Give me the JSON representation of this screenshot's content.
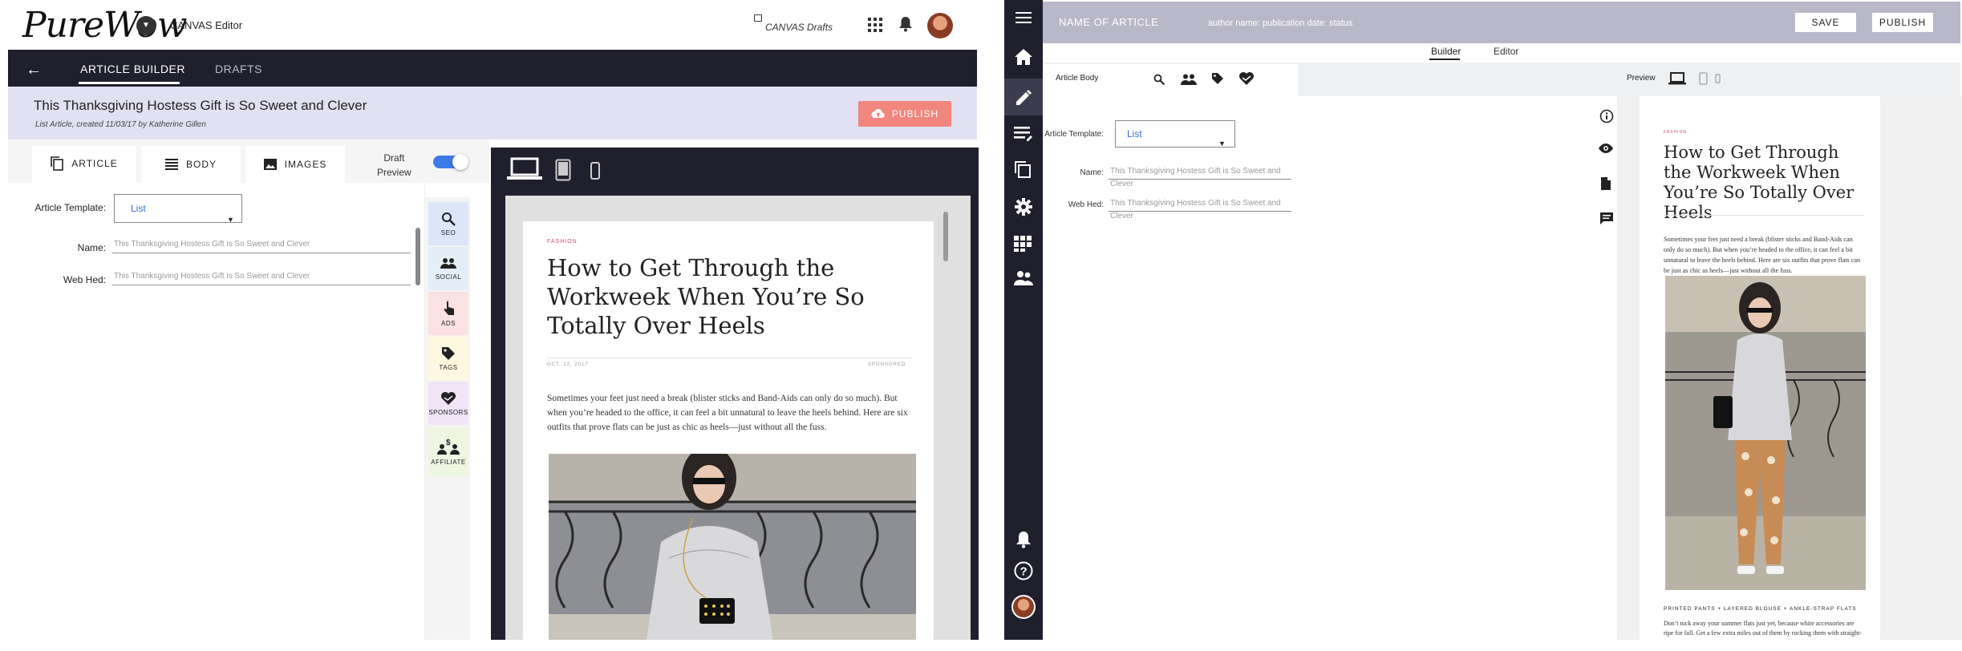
{
  "left": {
    "brand": "PureWow",
    "app_name": "CANVAS Editor",
    "drafts_link": "CANVAS Drafts",
    "nav": {
      "builder_tab": "ARTICLE BUILDER",
      "drafts_tab": "DRAFTS"
    },
    "article": {
      "title": "This Thanksgiving Hostess Gift is So Sweet and Clever",
      "meta": "List Article, created 11/03/17   by Katherine Gillen",
      "publish_label": "PUBLISH"
    },
    "tabs": [
      {
        "label": "ARTICLE",
        "icon": "copy-icon"
      },
      {
        "label": "BODY",
        "icon": "lines-icon"
      },
      {
        "label": "IMAGES",
        "icon": "image-icon"
      }
    ],
    "draft_preview_label_1": "Draft",
    "draft_preview_label_2": "Preview",
    "draft_preview_on": true,
    "form": {
      "template_label": "Article Template:",
      "template_value": "List",
      "name_label": "Name:",
      "name_value": "This Thanksgiving Hostess Gift is So Sweet and Clever",
      "webhed_label": "Web Hed:",
      "webhed_value": "This Thanksgiving Hostess Gift is So Sweet and Clever"
    },
    "side_tools": [
      {
        "label": "SEO",
        "icon": "search-icon",
        "color": "#dbe6fb"
      },
      {
        "label": "SOCIAL",
        "icon": "people-icon",
        "color": "#e4eef8"
      },
      {
        "label": "ADS",
        "icon": "touch-icon",
        "color": "#fbe1e1"
      },
      {
        "label": "TAGS",
        "icon": "tag-icon",
        "color": "#fff8e0"
      },
      {
        "label": "SPONSORS",
        "icon": "sponsor-heart-icon",
        "color": "#f1e4f7"
      },
      {
        "label": "AFFILIATE",
        "icon": "affiliate-icon",
        "color": "#eef6e2"
      }
    ],
    "preview": {
      "kicker": "FASHION",
      "headline": "How to Get Through the Workweek When You’re So Totally Over Heels",
      "date": "OCT. 22, 2017",
      "sponsored": "SPONSORED",
      "body": "Sometimes your feet just need a break (blister sticks and Band-Aids can only do so much). But when you’re headed to the office, it can feel a bit unnatural to leave the heels behind. Here are six outfits that prove flats can be just as chic as heels—just without all the fuss."
    }
  },
  "right": {
    "header": {
      "article_name": "NAME OF ARTICLE",
      "author_line": "author name: publication date: status",
      "save_label": "SAVE",
      "publish_label": "PUBLISH"
    },
    "subtabs": {
      "builder": "Builder",
      "editor": "Editor"
    },
    "toolbar": {
      "article_body": "Article Body",
      "preview": "Preview"
    },
    "form": {
      "template_label": "Article Template:",
      "template_value": "List",
      "name_label": "Name:",
      "name_value": "This Thanksgiving Hostess Gift is So Sweet and Clever",
      "webhed_label": "Web Hed:",
      "webhed_value": "This Thanksgiving Hostess Gift is So Sweet and Clever"
    },
    "preview": {
      "kicker": "FASHION",
      "headline": "How to Get Through the Workweek When You’re So Totally Over Heels",
      "body": "Sometimes your feet just need a break (blister sticks and Band-Aids can only do so much). But when you’re headed to the office, it can feel a bit unnatural to leave the heels behind. Here are six outfits that prove flats can be just as chic as heels—just without all the fuss.",
      "caption": "PRINTED PANTS + LAYERED BLOUSE + ANKLE-STRAP FLATS",
      "body2": "Don’t tuck away your summer flats just yet, because white accessories are ripe for fall. Get a few extra miles out of them by rocking them with straight-leg pants and layers up top for"
    }
  },
  "colors": {
    "nav_dark": "#1f1f2e",
    "accent_blue": "#3d7be9",
    "publish_coral": "#f0867e",
    "title_band": "#e1e1f2",
    "header_gray": "#b9b8c8",
    "kicker_pink": "#d04b6c"
  }
}
